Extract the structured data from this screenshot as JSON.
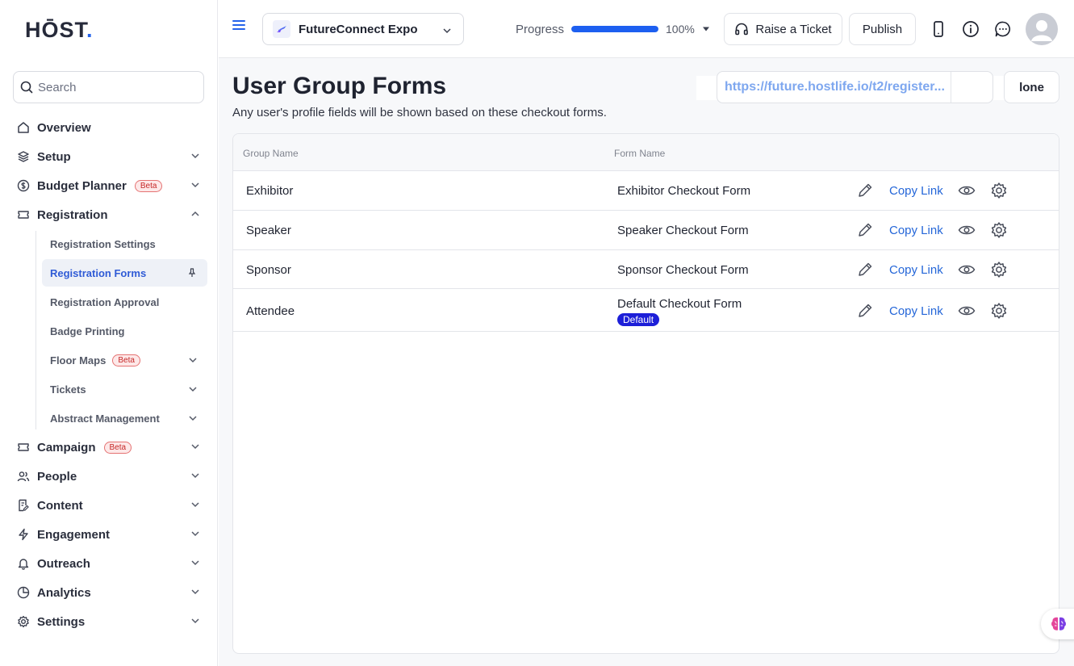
{
  "brand": {
    "logo_text": "HŌST",
    "logo_dot": "."
  },
  "search": {
    "placeholder": "Search"
  },
  "nav": {
    "overview": "Overview",
    "setup": "Setup",
    "budget_planner": "Budget Planner",
    "budget_badge": "Beta",
    "registration": "Registration",
    "campaign": "Campaign",
    "campaign_badge": "Beta",
    "people": "People",
    "content": "Content",
    "engagement": "Engagement",
    "outreach": "Outreach",
    "analytics": "Analytics",
    "settings": "Settings"
  },
  "registration_sub": {
    "settings": "Registration Settings",
    "forms": "Registration Forms",
    "approval": "Registration Approval",
    "badge_printing": "Badge Printing",
    "floor_maps": "Floor Maps",
    "floor_maps_badge": "Beta",
    "tickets": "Tickets",
    "abstract": "Abstract Management"
  },
  "topbar": {
    "event_name": "FutureConnect Expo",
    "progress_label": "Progress",
    "progress_value": 100,
    "progress_text": "100%",
    "raise_ticket": "Raise a Ticket",
    "publish": "Publish"
  },
  "page": {
    "title": "User Group Forms",
    "subtitle": "Any user's profile fields will be shown based on these checkout forms.",
    "link": "https://future.hostlife.io/t2/register...",
    "clone_label": "lone"
  },
  "table": {
    "columns": {
      "group": "Group Name",
      "form": "Form Name"
    },
    "copy_link_label": "Copy Link",
    "default_badge": "Default",
    "rows": [
      {
        "group": "Exhibitor",
        "form": "Exhibitor Checkout Form"
      },
      {
        "group": "Speaker",
        "form": "Speaker Checkout Form"
      },
      {
        "group": "Sponsor",
        "form": "Sponsor Checkout Form"
      },
      {
        "group": "Attendee",
        "form": "Default Checkout Form"
      }
    ]
  },
  "colors": {
    "accent": "#2563eb",
    "link_blue": "#2466d8",
    "beta_red": "#c62828",
    "default_badge": "#1d1fd8"
  }
}
